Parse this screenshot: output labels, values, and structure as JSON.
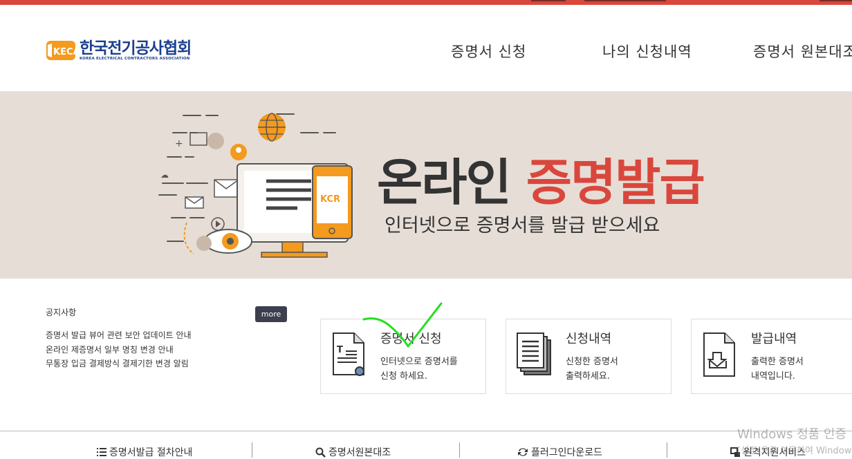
{
  "header": {
    "logo_text_ko": "한국전기공사협회",
    "logo_text_en": "KOREA ELECTRICAL CONTRACTORS ASSOCIATION",
    "logo_mark_text": "KECA",
    "nav": [
      "증명서 신청",
      "나의 신청내역",
      "증명서 원본대조"
    ]
  },
  "banner": {
    "title_dark": "온라인 ",
    "title_red": "증명발급",
    "subtitle": "인터넷으로 증명서를 발급 받으세요",
    "bg_color": "#e6ddd6",
    "accent_color": "#d9473c"
  },
  "notice": {
    "title": "공지사항",
    "more_label": "more",
    "items": [
      "증명서 발급 뷰어 관련 보안 업데이트 안내",
      "온라인 제증명서 일부 명칭 변경 안내",
      "무통장 입금 결제방식 결제기한 변경 알림"
    ]
  },
  "cards": [
    {
      "title": "증명서 신청",
      "desc1": "인터넷으로 증명서를",
      "desc2": "신청 하세요.",
      "icon": "document-pen-icon"
    },
    {
      "title": "신청내역",
      "desc1": "신청한 증명서",
      "desc2": "출력하세요.",
      "icon": "stacked-documents-icon"
    },
    {
      "title": "발급내역",
      "desc1": "출력한 증명서",
      "desc2": "내역입니다.",
      "icon": "document-download-icon"
    }
  ],
  "bottom": [
    {
      "label": "증명서발급 절차안내",
      "icon": "list-icon"
    },
    {
      "label": "증명서원본대조",
      "icon": "search-icon"
    },
    {
      "label": "플러그인다운로드",
      "icon": "refresh-icon"
    },
    {
      "label": "원격지원서비스",
      "icon": "remote-icon"
    }
  ],
  "watermark": {
    "line1": "Windows 정품 인증",
    "line2": "[설정]으로 이동하여 Windows를"
  }
}
